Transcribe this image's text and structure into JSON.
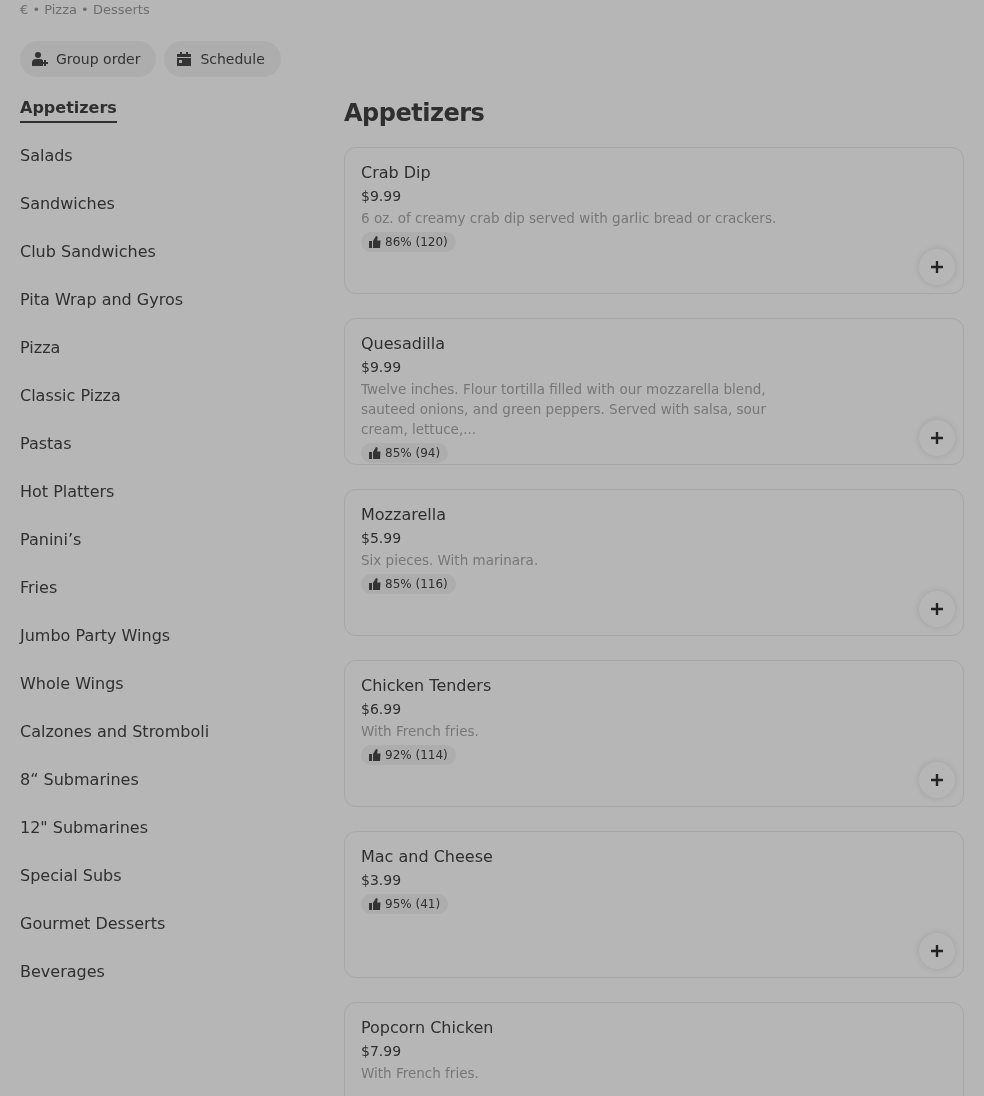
{
  "breadcrumb": "€ • Pizza • Desserts",
  "actions": [
    {
      "kind": "group",
      "label": "Group order"
    },
    {
      "kind": "schedule",
      "label": "Schedule"
    }
  ],
  "categories": [
    {
      "label": "Appetizers",
      "selected": true
    },
    {
      "label": "Salads",
      "selected": false
    },
    {
      "label": "Sandwiches",
      "selected": false
    },
    {
      "label": "Club Sandwiches",
      "selected": false
    },
    {
      "label": "Pita Wrap and Gyros",
      "selected": false
    },
    {
      "label": "Pizza",
      "selected": false
    },
    {
      "label": "Classic Pizza",
      "selected": false
    },
    {
      "label": "Pastas",
      "selected": false
    },
    {
      "label": "Hot Platters",
      "selected": false
    },
    {
      "label": "Panini’s",
      "selected": false
    },
    {
      "label": "Fries",
      "selected": false
    },
    {
      "label": "Jumbo Party Wings",
      "selected": false
    },
    {
      "label": "Whole Wings",
      "selected": false
    },
    {
      "label": "Calzones and Stromboli",
      "selected": false
    },
    {
      "label": "8“ Submarines",
      "selected": false
    },
    {
      "label": "12\" Submarines",
      "selected": false
    },
    {
      "label": "Special Subs",
      "selected": false
    },
    {
      "label": "Gourmet Desserts",
      "selected": false
    },
    {
      "label": "Beverages",
      "selected": false
    }
  ],
  "section_title": "Appetizers",
  "items": [
    {
      "name": "Crab Dip",
      "price": "$9.99",
      "description": "6 oz. of creamy crab dip served with garlic bread or crackers.",
      "rating": "86% (120)"
    },
    {
      "name": "Quesadilla",
      "price": "$9.99",
      "description": "Twelve inches. Flour tortilla filled with our mozzarella blend, sauteed onions, and green peppers. Served with salsa, sour cream, lettuce,...",
      "rating": "85% (94)"
    },
    {
      "name": "Mozzarella",
      "price": "$5.99",
      "description": "Six pieces. With marinara.",
      "rating": "85% (116)"
    },
    {
      "name": "Chicken Tenders",
      "price": "$6.99",
      "description": "With French fries.",
      "rating": "92% (114)"
    },
    {
      "name": "Mac and Cheese",
      "price": "$3.99",
      "rating": "95% (41)"
    },
    {
      "name": "Popcorn Chicken",
      "price": "$7.99",
      "description": "With French fries."
    }
  ]
}
